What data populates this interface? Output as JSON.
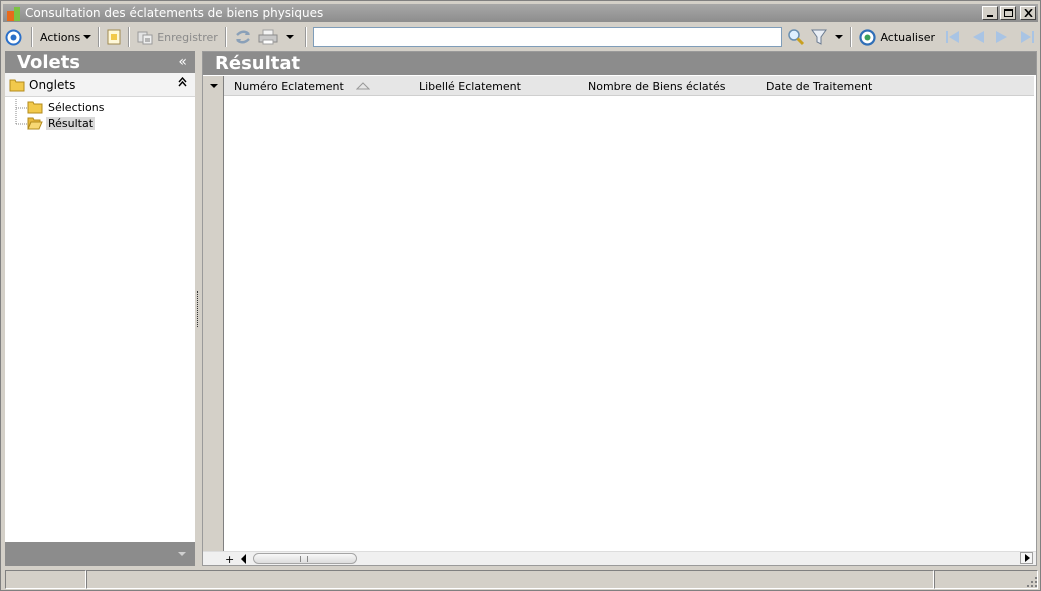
{
  "window": {
    "title": "Consultation des éclatements de biens physiques",
    "controls": {
      "minimize": "minimize",
      "maximize": "maximize",
      "close": "close"
    }
  },
  "toolbar": {
    "actions_label": "Actions",
    "save_label": "Enregistrer",
    "search_value": "",
    "refresh_label": "Actualiser",
    "icons": [
      "nav-circle-icon",
      "new-document-icon",
      "save-icon",
      "sync-icon",
      "print-icon",
      "search-icon",
      "filter-icon",
      "refresh-icon",
      "first-page-icon",
      "prev-page-icon",
      "next-page-icon",
      "last-page-icon"
    ]
  },
  "left_panel": {
    "title": "Volets",
    "collapse_glyph": "«",
    "group": {
      "label": "Onglets",
      "collapse_glyph": "»"
    },
    "tree": [
      {
        "label": "Sélections",
        "selected": false
      },
      {
        "label": "Résultat",
        "selected": true
      }
    ]
  },
  "right_panel": {
    "title": "Résultat",
    "columns": [
      {
        "label": "Numéro Eclatement",
        "sorted": "ascending"
      },
      {
        "label": "Libellé Eclatement"
      },
      {
        "label": "Nombre de Biens éclatés"
      },
      {
        "label": "Date de Traitement"
      }
    ],
    "rows": [],
    "scroll_plus": "+"
  },
  "status_bar": {
    "cells": [
      "",
      "",
      ""
    ]
  },
  "colors": {
    "panel_header": "#8c8c8c",
    "title_bar": "#9a9a9a",
    "window_bg": "#d4d0c8",
    "accent_blue": "#2a6fc9"
  }
}
